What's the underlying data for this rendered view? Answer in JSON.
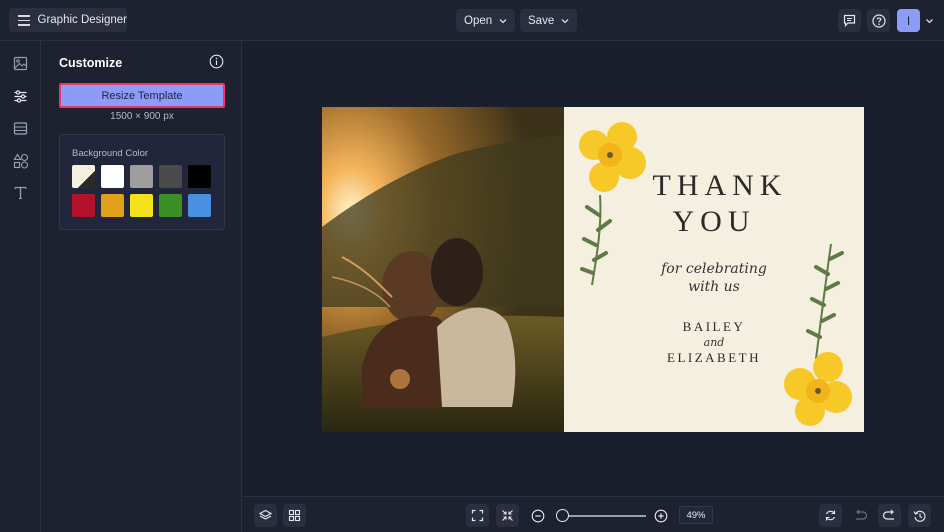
{
  "header": {
    "app_title": "Graphic Designer",
    "open_label": "Open",
    "save_label": "Save",
    "avatar_initial": "I"
  },
  "rail": {
    "items": [
      "image-icon",
      "sliders-icon",
      "layout-icon",
      "shapes-icon",
      "text-icon"
    ],
    "active": "sliders-icon"
  },
  "panel": {
    "title": "Customize",
    "resize_button": "Resize Template",
    "dimensions": "1500 × 900 px",
    "background_label": "Background Color",
    "swatches": [
      "#f4efdf",
      "#ffffff",
      "#9e9e9e",
      "#4a4a4a",
      "#000000",
      "#b4122a",
      "#e0a01b",
      "#f5e11b",
      "#3b8f25",
      "#4a90e2"
    ]
  },
  "card": {
    "line1": "THANK",
    "line2": "YOU",
    "script1": "for celebrating",
    "script2": "with us",
    "name1": "BAILEY",
    "and": "and",
    "name2": "ELIZABETH"
  },
  "footer": {
    "zoom": "49%",
    "zoom_fraction": 0.1
  },
  "colors": {
    "accent": "#8d9cf8",
    "highlight_border": "#e8366d",
    "background": "#1e2130",
    "card_bg": "#f4efdf",
    "flower_yellow": "#f6c928",
    "leaf_green": "#5e7a45"
  }
}
